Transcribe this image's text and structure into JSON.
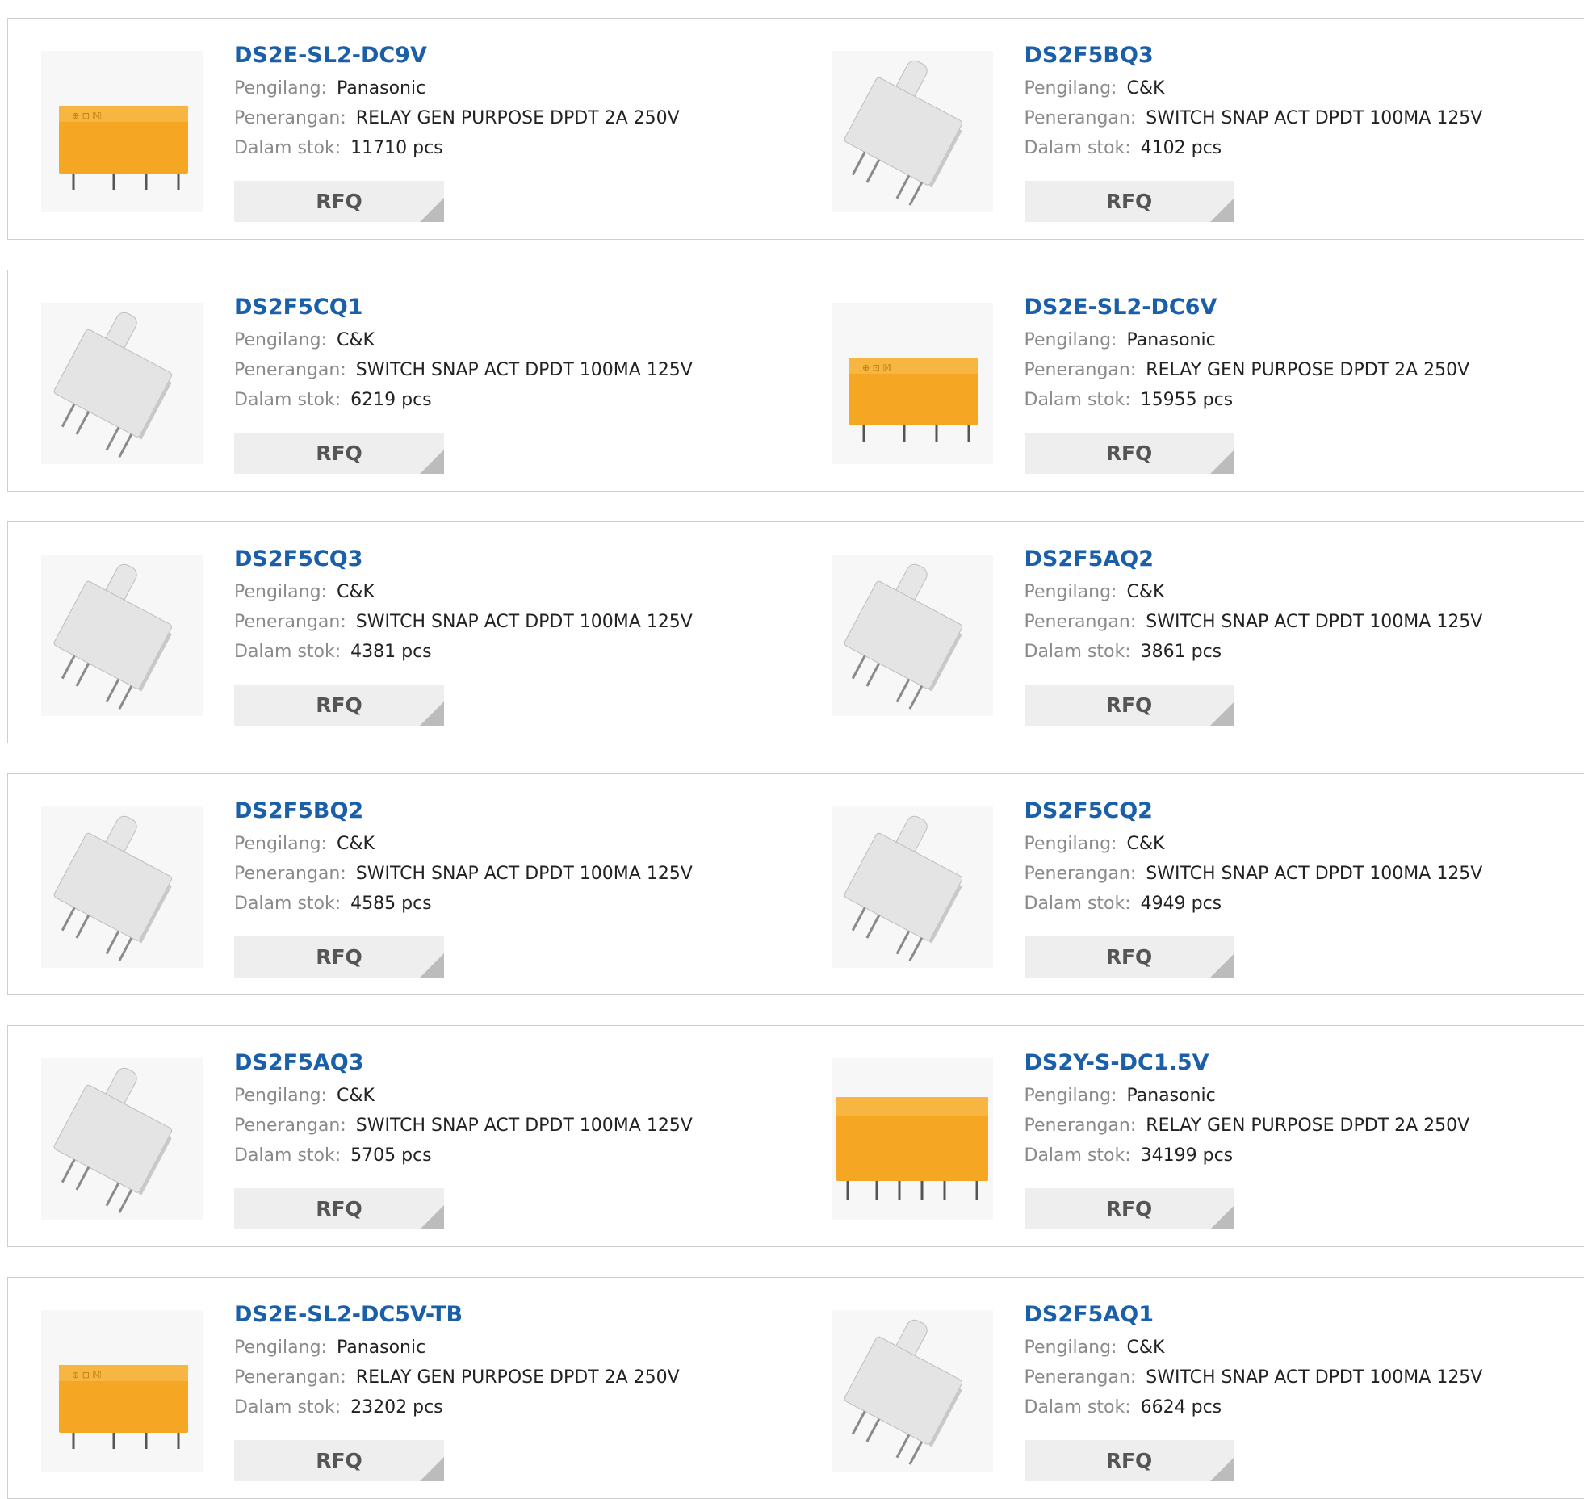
{
  "labels": {
    "manufacturer": "Pengilang:",
    "description": "Penerangan:",
    "stock": "Dalam stok:",
    "rfq": "RFQ"
  },
  "products": [
    {
      "part": "DS2E-SL2-DC9V",
      "manufacturer": "Panasonic",
      "description": "RELAY GEN PURPOSE DPDT 2A 250V",
      "stock": "11710 pcs",
      "image_icon": "relay-icon"
    },
    {
      "part": "DS2F5BQ3",
      "manufacturer": "C&K",
      "description": "SWITCH SNAP ACT DPDT 100MA 125V",
      "stock": "4102 pcs",
      "image_icon": "snap-switch-icon"
    },
    {
      "part": "DS2F5CQ1",
      "manufacturer": "C&K",
      "description": "SWITCH SNAP ACT DPDT 100MA 125V",
      "stock": "6219 pcs",
      "image_icon": "snap-switch-icon"
    },
    {
      "part": "DS2E-SL2-DC6V",
      "manufacturer": "Panasonic",
      "description": "RELAY GEN PURPOSE DPDT 2A 250V",
      "stock": "15955 pcs",
      "image_icon": "relay-icon"
    },
    {
      "part": "DS2F5CQ3",
      "manufacturer": "C&K",
      "description": "SWITCH SNAP ACT DPDT 100MA 125V",
      "stock": "4381 pcs",
      "image_icon": "snap-switch-icon"
    },
    {
      "part": "DS2F5AQ2",
      "manufacturer": "C&K",
      "description": "SWITCH SNAP ACT DPDT 100MA 125V",
      "stock": "3861 pcs",
      "image_icon": "snap-switch-icon"
    },
    {
      "part": "DS2F5BQ2",
      "manufacturer": "C&K",
      "description": "SWITCH SNAP ACT DPDT 100MA 125V",
      "stock": "4585 pcs",
      "image_icon": "snap-switch-icon"
    },
    {
      "part": "DS2F5CQ2",
      "manufacturer": "C&K",
      "description": "SWITCH SNAP ACT DPDT 100MA 125V",
      "stock": "4949 pcs",
      "image_icon": "snap-switch-icon"
    },
    {
      "part": "DS2F5AQ3",
      "manufacturer": "C&K",
      "description": "SWITCH SNAP ACT DPDT 100MA 125V",
      "stock": "5705 pcs",
      "image_icon": "snap-switch-icon"
    },
    {
      "part": "DS2Y-S-DC1.5V",
      "manufacturer": "Panasonic",
      "description": "RELAY GEN PURPOSE DPDT 2A 250V",
      "stock": "34199 pcs",
      "image_icon": "relay-icon"
    },
    {
      "part": "DS2E-SL2-DC5V-TB",
      "manufacturer": "Panasonic",
      "description": "RELAY GEN PURPOSE DPDT 2A 250V",
      "stock": "23202 pcs",
      "image_icon": "relay-icon"
    },
    {
      "part": "DS2F5AQ1",
      "manufacturer": "C&K",
      "description": "SWITCH SNAP ACT DPDT 100MA 125V",
      "stock": "6624 pcs",
      "image_icon": "snap-switch-icon"
    }
  ],
  "colors": {
    "link": "#1a5fa8",
    "label": "#8a8a8a",
    "relay_body": "#f5a623",
    "switch_body": "#e4e4e4",
    "button_bg": "#eeeeee"
  }
}
